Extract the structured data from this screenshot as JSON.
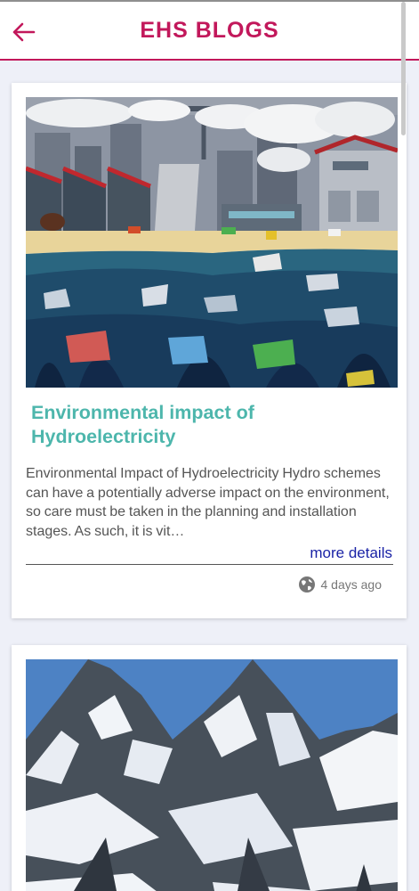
{
  "app": {
    "title": "EHS BLOGS"
  },
  "icons": {
    "back": "arrow-left-icon",
    "globe": "globe-icon"
  },
  "colors": {
    "accent": "#c2185b",
    "title": "#4db6ac",
    "link": "#1a23a6"
  },
  "posts": [
    {
      "title": "Environmental impact of Hydroelectricity",
      "excerpt": "  Environmental Impact of Hydroelectricity    Hydro schemes can have a potentially adverse impact on the environment, so care must be taken in the planning and installation stages. As such, it is vit…",
      "more_label": "more details",
      "time": "4 days ago",
      "image": "industrial-pollution-illustration"
    },
    {
      "image": "snowy-mountain-photo"
    }
  ]
}
